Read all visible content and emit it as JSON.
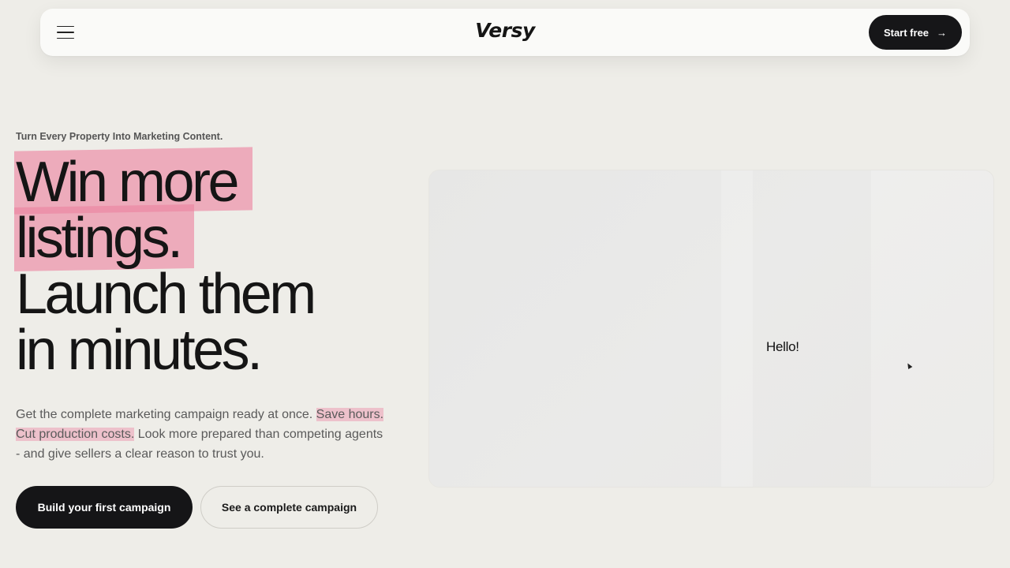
{
  "nav": {
    "logo": "Versy",
    "start_label": "Start free",
    "start_icon": "arrow-right-icon",
    "menu_icon": "hamburger-menu-icon"
  },
  "hero": {
    "eyebrow": "Turn Every Property Into Marketing Content.",
    "headline_line1": "Win more",
    "headline_line2": "listings.",
    "headline_line3": "Launch them",
    "headline_line4": "in minutes.",
    "lede_part1": "Get the complete marketing campaign ready at once. ",
    "lede_highlight": "Save hours. Cut production costs.",
    "lede_part2": " Look more prepared than competing agents - and give sellers a clear reason to trust you.",
    "primary_cta": "Build your first campaign",
    "secondary_cta": "See a complete campaign"
  },
  "preview": {
    "greeting": "Hello!"
  },
  "colors": {
    "background": "#eeede8",
    "highlight": "#ec82a0",
    "dark": "#161618"
  }
}
